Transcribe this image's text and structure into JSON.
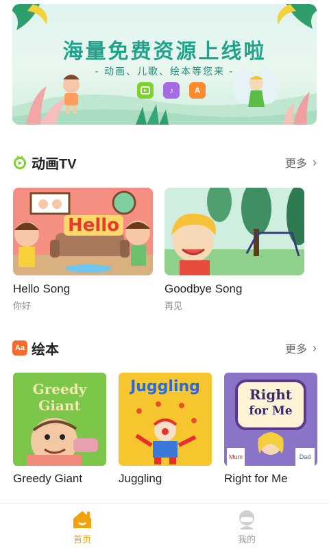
{
  "banner": {
    "title": "海量免费资源上线啦",
    "subtitle": "- 动画、儿歌、绘本等您来 -"
  },
  "sections": {
    "videos": {
      "title": "动画TV",
      "more_label": "更多",
      "items": [
        {
          "title": "Hello Song",
          "subtitle": "你好",
          "art_text": "Hello"
        },
        {
          "title": "Goodbye Song",
          "subtitle": "再见"
        }
      ]
    },
    "books": {
      "title": "绘本",
      "icon_text": "Aa",
      "more_label": "更多",
      "items": [
        {
          "title": "Greedy Giant",
          "art_text_1": "Greedy",
          "art_text_2": "Giant"
        },
        {
          "title": "Juggling",
          "art_text": "Juggling"
        },
        {
          "title": "Right for Me",
          "art_text_1": "Right",
          "art_text_2": "for Me",
          "art_text_3": "Mum",
          "art_text_4": "Dad"
        }
      ]
    }
  },
  "bottom_nav": {
    "items": [
      {
        "label": "首页",
        "icon": "home-icon",
        "active": true
      },
      {
        "label": "我的",
        "icon": "profile-icon",
        "active": false
      }
    ]
  },
  "colors": {
    "accent": "#f2a20c",
    "tv_green": "#7fd12b",
    "book_orange": "#ff6a2a",
    "banner_title": "#1ea48b"
  }
}
